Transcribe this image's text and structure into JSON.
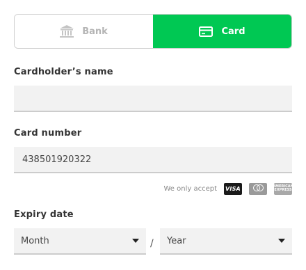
{
  "tabs": [
    {
      "label": "Bank",
      "icon": "bank-icon",
      "active": false
    },
    {
      "label": "Card",
      "icon": "credit-card-icon",
      "active": true
    }
  ],
  "cardholder": {
    "label": "Cardholder’s name",
    "value": "",
    "placeholder": ""
  },
  "card_number": {
    "label": "Card number",
    "value": "438501920322"
  },
  "accepted_cards": {
    "text": "We only accept",
    "brands": [
      "visa-icon",
      "mastercard-icon",
      "amex-icon"
    ],
    "visa_label": "VISA",
    "amex_label_top": "AMERICAN",
    "amex_label_bottom": "EXPRESS"
  },
  "expiry": {
    "label": "Expiry date",
    "month_placeholder": "Month",
    "separator": "/",
    "year_placeholder": "Year"
  },
  "colors": {
    "accent": "#00c853",
    "inactive_text": "#b5b5b5",
    "input_bg": "#f2f2f2"
  }
}
